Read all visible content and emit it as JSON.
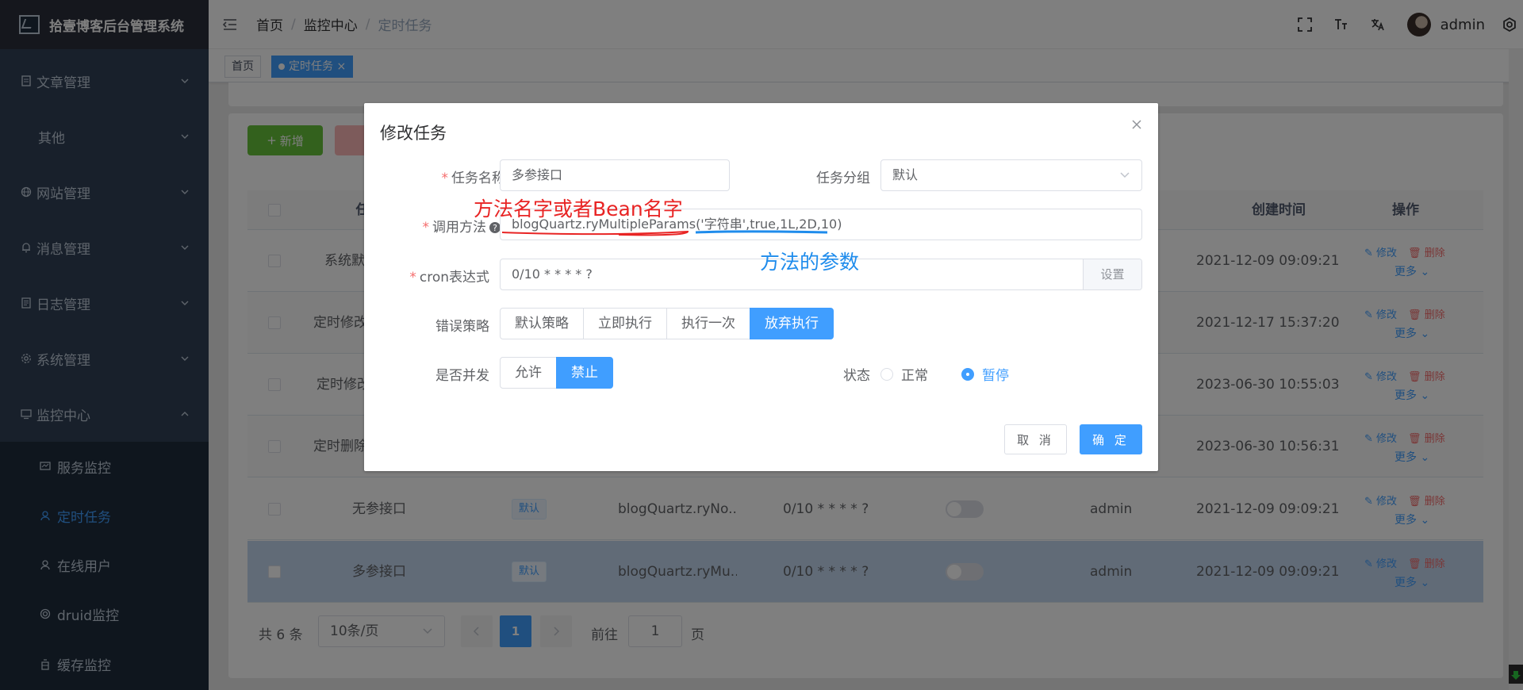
{
  "app": {
    "title": "拾壹博客后台管理系统"
  },
  "sidebar": {
    "items": [
      {
        "label": "文章管理",
        "icon": "document-icon"
      },
      {
        "label": "其他"
      },
      {
        "label": "网站管理",
        "icon": "globe-icon"
      },
      {
        "label": "消息管理",
        "icon": "bell-icon"
      },
      {
        "label": "日志管理",
        "icon": "log-icon"
      },
      {
        "label": "系统管理",
        "icon": "gear-icon"
      },
      {
        "label": "监控中心",
        "icon": "monitor-icon"
      }
    ],
    "monitor_sub": [
      {
        "label": "服务监控",
        "icon": "server-icon"
      },
      {
        "label": "定时任务",
        "icon": "clock-icon"
      },
      {
        "label": "在线用户",
        "icon": "user-icon"
      },
      {
        "label": "druid监控",
        "icon": "druid-icon"
      },
      {
        "label": "缓存监控",
        "icon": "cache-icon"
      }
    ]
  },
  "navbar": {
    "breadcrumb": [
      "首页",
      "监控中心",
      "定时任务"
    ],
    "sep": "/",
    "username": "admin"
  },
  "tags": {
    "home": "首页",
    "active": "定时任务",
    "close": "×"
  },
  "toolbar": {
    "add_label": "新增"
  },
  "table": {
    "headers": {
      "name": "任",
      "create_time": "创建时间",
      "actions": "操作"
    },
    "rows": [
      {
        "name": "系统默",
        "create_time": "2021-12-09 09:09:21"
      },
      {
        "name": "定时修改",
        "create_time": "2021-12-17 15:37:20"
      },
      {
        "name": "定时修改",
        "create_time": "2023-06-30 10:55:03"
      },
      {
        "name": "定时删除",
        "create_time": "2023-06-30 10:56:31"
      },
      {
        "name": "无参接口",
        "group": "默认",
        "invoke": "blogQuartz.ryNo...",
        "cron": "0/10 * * * * ?",
        "creator": "admin",
        "create_time": "2021-12-09 09:09:21"
      },
      {
        "name": "多参接口",
        "group": "默认",
        "invoke": "blogQuartz.ryMu...",
        "cron": "0/10 * * * * ?",
        "creator": "admin",
        "create_time": "2021-12-09 09:09:21"
      }
    ],
    "edit_label": "修改",
    "delete_label": "删除",
    "more_label": "更多"
  },
  "pagination": {
    "total": "共 6 条",
    "page_size": "10条/页",
    "current": "1",
    "goto_label": "前往",
    "goto_value": "1",
    "page_label": "页"
  },
  "dialog": {
    "title": "修改任务",
    "fields": {
      "job_name_label": "任务名称",
      "job_name_value": "多参接口",
      "job_group_label": "任务分组",
      "job_group_value": "默认",
      "invoke_label": "调用方法",
      "invoke_value": "blogQuartz.ryMultipleParams('字符串',true,1L,2D,10)",
      "cron_label": "cron表达式",
      "cron_value": "0/10 * * * * ?",
      "cron_setting": "设置",
      "misfire_label": "错误策略",
      "misfire_options": [
        "默认策略",
        "立即执行",
        "执行一次",
        "放弃执行"
      ],
      "misfire_selected": "放弃执行",
      "concurrent_label": "是否并发",
      "concurrent_options": [
        "允许",
        "禁止"
      ],
      "concurrent_selected": "禁止",
      "status_label": "状态",
      "status_options": [
        "正常",
        "暂停"
      ],
      "status_selected": "暂停"
    },
    "cancel_label": "取 消",
    "confirm_label": "确 定",
    "help_mark": "?"
  },
  "annotations": {
    "red": "方法名字或者Bean名字",
    "blue": "方法的参数",
    "red_color": "#e82424",
    "blue_color": "#1f8cec"
  },
  "colors": {
    "primary": "#409eff",
    "success": "#67c23a",
    "danger": "#f56c6c",
    "sidebar_bg": "#304156"
  }
}
